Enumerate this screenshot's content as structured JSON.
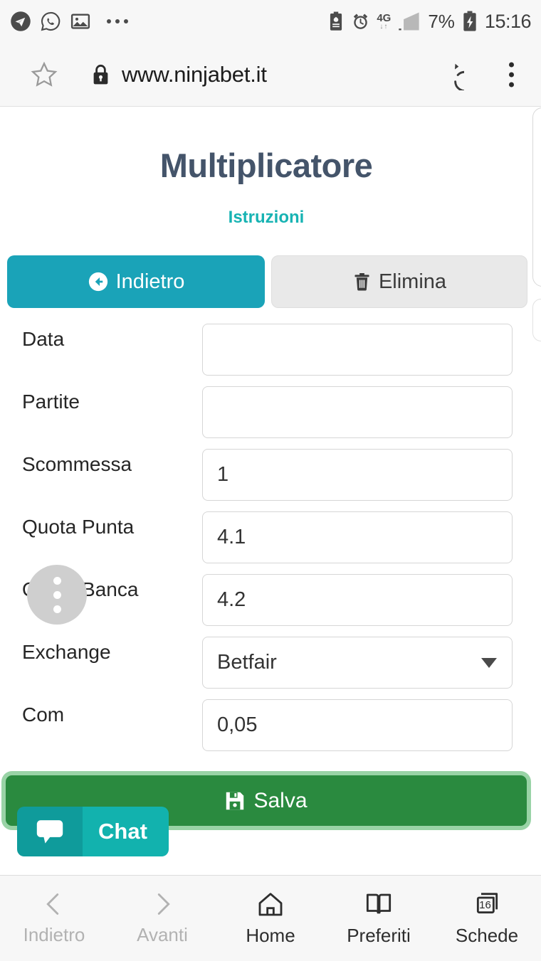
{
  "status_bar": {
    "left_icons": [
      "telegram-icon",
      "whatsapp-icon",
      "screenshot-icon",
      "more-notifications-icon"
    ],
    "right_icons": [
      "battery-saver-icon",
      "alarm-icon",
      "signal-icon",
      "charging-battery-icon"
    ],
    "network": "4G",
    "battery_percent": "7%",
    "time": "15:16"
  },
  "browser": {
    "bookmark_icon": "star-icon",
    "lock_icon": "lock-icon",
    "url": "www.ninjabet.it",
    "reload_icon": "reload-icon",
    "menu_icon": "overflow-menu-icon"
  },
  "page": {
    "title": "Multiplicatore",
    "instructions_link": "Istruzioni",
    "actions": {
      "back_label": "Indietro",
      "back_icon": "circle-arrow-left-icon",
      "delete_label": "Elimina",
      "delete_icon": "trash-icon"
    },
    "fields": [
      {
        "label": "Data",
        "value": "",
        "type": "text"
      },
      {
        "label": "Partite",
        "value": "",
        "type": "text"
      },
      {
        "label": "Scommessa",
        "value": "1",
        "type": "text"
      },
      {
        "label": "Quota Punta",
        "value": "4.1",
        "type": "text"
      },
      {
        "label": "Quota Banca",
        "value": "4.2",
        "type": "text"
      },
      {
        "label": "Exchange",
        "value": "Betfair",
        "type": "select"
      },
      {
        "label": "Com",
        "value": "0,05",
        "type": "text"
      }
    ],
    "exchange_options": [
      "Betfair"
    ],
    "save": {
      "label": "Salva",
      "icon": "floppy-save-icon"
    },
    "overflow_fab": "vertical-dots-icon",
    "chat": {
      "label": "Chat",
      "icon": "chat-bubble-icon"
    }
  },
  "bottom_nav": [
    {
      "label": "Indietro",
      "icon": "chevron-left-icon",
      "disabled": true
    },
    {
      "label": "Avanti",
      "icon": "chevron-right-icon",
      "disabled": true
    },
    {
      "label": "Home",
      "icon": "home-icon",
      "disabled": false
    },
    {
      "label": "Preferiti",
      "icon": "book-icon",
      "disabled": false
    },
    {
      "label": "Schede",
      "icon": "tabs-icon",
      "disabled": false,
      "count": "16"
    }
  ],
  "colors": {
    "teal": "#1aa3b8",
    "instructions_teal": "#17b3b3",
    "title_slate": "#44546a",
    "save_green": "#2a8a3f",
    "save_ring": "#99d3a6",
    "chat_teal": "#12b2ae",
    "delete_grey": "#e9e9e9"
  }
}
